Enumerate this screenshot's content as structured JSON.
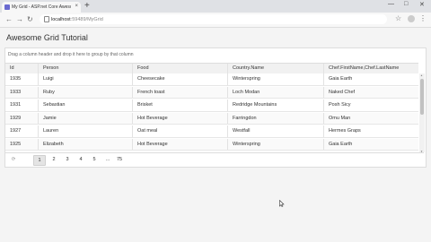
{
  "browser": {
    "tab_title": "My Grid - ASP.net Core Awesom...",
    "tab_close": "×",
    "new_tab": "+",
    "url_host": "localhost",
    "url_path": ":59489/MyGrid",
    "window_min": "—",
    "window_max": "□",
    "window_close": "✕"
  },
  "page": {
    "title": "Awesome Grid Tutorial",
    "group_hint": "Drag a column header and drop it here to group by that column"
  },
  "grid": {
    "columns": [
      "Id",
      "Person",
      "Food",
      "Country.Name",
      "Chef.FirstName,Chef.LastName"
    ],
    "rows": [
      [
        "1935",
        "Luigi",
        "Cheesecake",
        "Winterspring",
        "Gaia Earth"
      ],
      [
        "1933",
        "Ruby",
        "French toast",
        "Loch Modan",
        "Naked Chef"
      ],
      [
        "1931",
        "Sebastian",
        "Brisket",
        "Redridge Mountains",
        "Posh Sicy"
      ],
      [
        "1929",
        "Jamie",
        "Hot Beverage",
        "Farringdon",
        "Omu Man"
      ],
      [
        "1927",
        "Lauren",
        "Oat meal",
        "Westfall",
        "Hermes Graps"
      ],
      [
        "1925",
        "Elizabeth",
        "Hot Beverage",
        "Winterspring",
        "Gaia Earth"
      ]
    ]
  },
  "pager": {
    "refresh": "⟳",
    "pages": [
      "1",
      "2",
      "3",
      "4",
      "5",
      "...",
      "75"
    ],
    "current": "1"
  }
}
